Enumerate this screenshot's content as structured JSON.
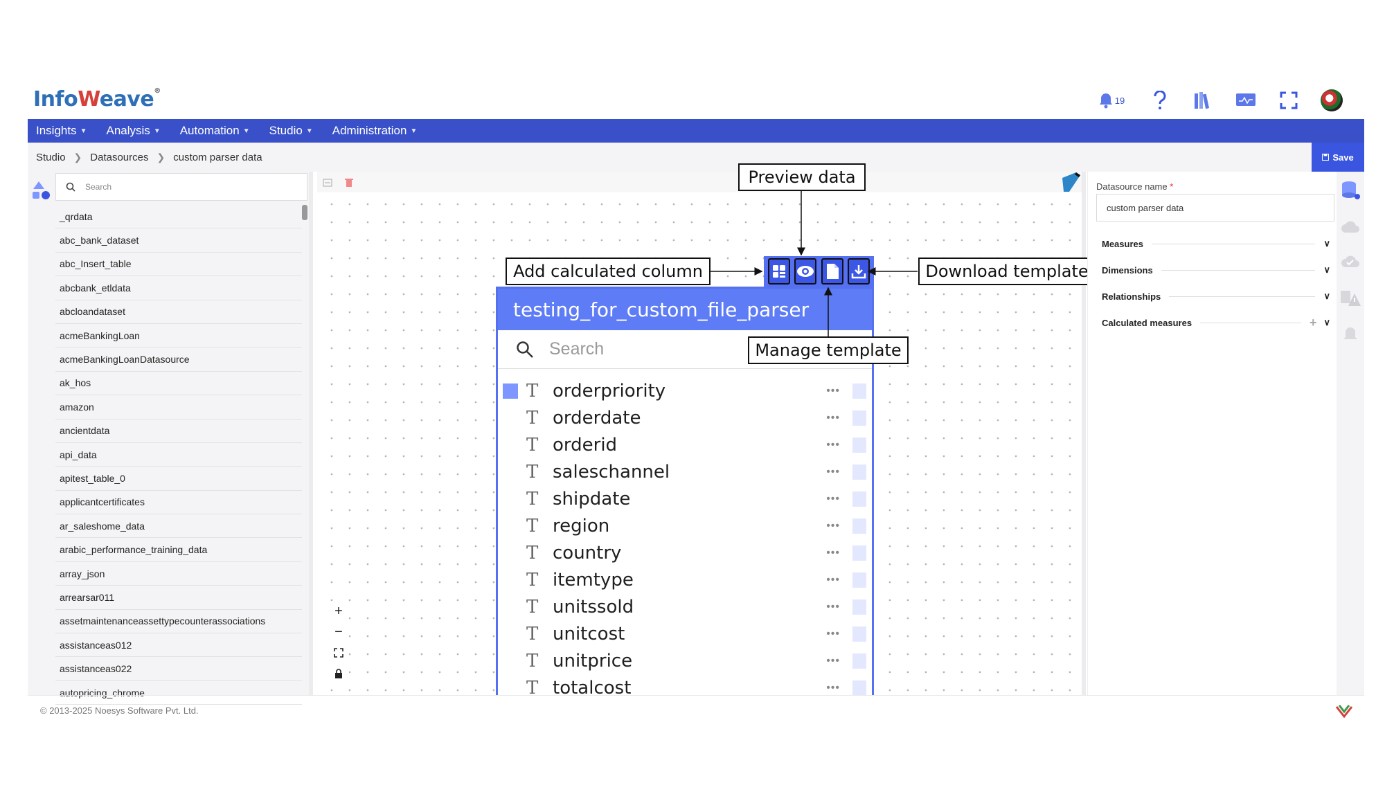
{
  "brand": {
    "logo_prefix": "Info",
    "logo_w": "W",
    "logo_suffix": "eave",
    "logo_mark": "®"
  },
  "top_icons": {
    "bell_count": "19"
  },
  "nav": [
    "Insights",
    "Analysis",
    "Automation",
    "Studio",
    "Administration"
  ],
  "breadcrumb": [
    "Studio",
    "Datasources",
    "custom parser data"
  ],
  "save_label": "Save",
  "left": {
    "search_placeholder": "Search",
    "datasources": [
      "_qrdata",
      "abc_bank_dataset",
      "abc_Insert_table",
      "abcbank_etldata",
      "abcloandataset",
      "acmeBankingLoan",
      "acmeBankingLoanDatasource",
      "ak_hos",
      "amazon",
      "ancientdata",
      "api_data",
      "apitest_table_0",
      "applicantcertificates",
      "ar_saleshome_data",
      "arabic_performance_training_data",
      "array_json",
      "arrearsar011",
      "assetmaintenanceassettypecounterassociations",
      "assistanceas012",
      "assistanceas022",
      "autopricing_chrome"
    ]
  },
  "card": {
    "title": "testing_for_custom_file_parser",
    "search_placeholder": "Search",
    "type_glyph": "T",
    "fields": [
      "orderpriority",
      "orderdate",
      "orderid",
      "saleschannel",
      "shipdate",
      "region",
      "country",
      "itemtype",
      "unitssold",
      "unitcost",
      "unitprice",
      "totalcost"
    ],
    "dots": "•••"
  },
  "callouts": {
    "add_calculated_column": "Add calculated column",
    "preview_data": "Preview data",
    "download_template": "Download template",
    "manage_template": "Manage template"
  },
  "zoom": {
    "plus": "+",
    "minus": "−"
  },
  "right": {
    "ds_name_label": "Datasource name",
    "required_mark": "*",
    "ds_name_value": "custom parser data",
    "sections": [
      "Measures",
      "Dimensions",
      "Relationships",
      "Calculated measures"
    ],
    "plus": "+"
  },
  "footer": {
    "copyright": "© 2013-2025 Noesys Software Pvt. Ltd."
  },
  "colors": {
    "nav": "#3a50c9",
    "accent": "#5570f0",
    "card_header": "#5e7cf5",
    "save": "#3a55e0"
  }
}
